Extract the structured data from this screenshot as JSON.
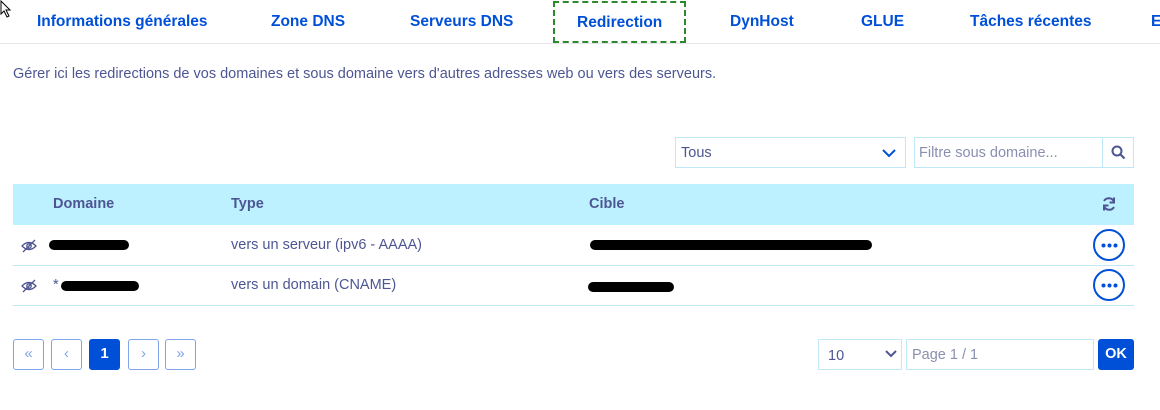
{
  "tabs": [
    {
      "label": "Informations générales"
    },
    {
      "label": "Zone DNS"
    },
    {
      "label": "Serveurs DNS"
    },
    {
      "label": "Redirection",
      "active": true
    },
    {
      "label": "DynHost"
    },
    {
      "label": "GLUE"
    },
    {
      "label": "Tâches récentes"
    },
    {
      "label": "E"
    }
  ],
  "intro": "Gérer ici les redirections de vos domaines et sous domaine vers d'autres adresses web ou vers des serveurs.",
  "filter": {
    "select_value": "Tous",
    "search_placeholder": "Filtre sous domaine..."
  },
  "table": {
    "headers": {
      "domain": "Domaine",
      "type": "Type",
      "target": "Cible"
    },
    "rows": [
      {
        "domain_prefix": "",
        "type": "vers un serveur (ipv6 - AAAA)"
      },
      {
        "domain_prefix": "*",
        "type": "vers un domain (CNAME)"
      }
    ]
  },
  "pagination": {
    "first": "«",
    "prev": "‹",
    "current": "1",
    "next": "›",
    "last": "»",
    "per_page": "10",
    "page_placeholder": "Page 1 / 1",
    "ok_label": "OK"
  },
  "colors": {
    "accent": "#0050d7",
    "text": "#4d5693",
    "header_bg": "#bef1ff",
    "border": "#bfe9f7",
    "active_tab_outline": "#2c8a2c"
  },
  "icons": {
    "cursor": "mouse-pointer-icon",
    "chevron": "chevron-down-icon",
    "search": "search-icon",
    "refresh": "refresh-icon",
    "hidden": "eye-slash-icon",
    "more": "ellipsis-icon"
  }
}
